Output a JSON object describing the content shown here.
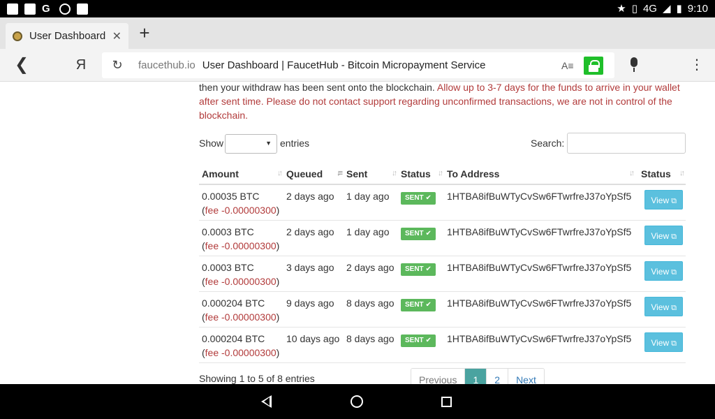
{
  "statusbar": {
    "network": "4G",
    "network_sup": "4G",
    "time": "9:10"
  },
  "tabs": [
    {
      "label": "User Dashboard"
    }
  ],
  "address": {
    "domain": "faucethub.io",
    "title": "User Dashboard | FaucetHub - Bitcoin Micropayment Service"
  },
  "notice": {
    "text": "then your withdraw has been sent onto the blockchain. ",
    "warning": "Allow up to 3-7 days for the funds to arrive in your wallet after sent time. Please do not contact support regarding unconfirmed transactions, we are not in control of the blockchain."
  },
  "controls": {
    "show_label": "Show",
    "entries_label": "entries",
    "search_label": "Search:",
    "search_value": ""
  },
  "table": {
    "columns": [
      "Amount",
      "Queued",
      "Sent",
      "Status",
      "To Address",
      "Status"
    ],
    "rows": [
      {
        "amount": "0.00035 BTC",
        "fee": "fee -0.00000300",
        "queued": "2 days ago",
        "sent": "1 day ago",
        "status": "SENT",
        "address": "1HTBA8ifBuWTyCvSw6FTwrfreJ37oYpSf5",
        "action": "View"
      },
      {
        "amount": "0.0003 BTC",
        "fee": "fee -0.00000300",
        "queued": "2 days ago",
        "sent": "1 day ago",
        "status": "SENT",
        "address": "1HTBA8ifBuWTyCvSw6FTwrfreJ37oYpSf5",
        "action": "View"
      },
      {
        "amount": "0.0003 BTC",
        "fee": "fee -0.00000300",
        "queued": "3 days ago",
        "sent": "2 days ago",
        "status": "SENT",
        "address": "1HTBA8ifBuWTyCvSw6FTwrfreJ37oYpSf5",
        "action": "View"
      },
      {
        "amount": "0.000204 BTC",
        "fee": "fee -0.00000300",
        "queued": "9 days ago",
        "sent": "8 days ago",
        "status": "SENT",
        "address": "1HTBA8ifBuWTyCvSw6FTwrfreJ37oYpSf5",
        "action": "View"
      },
      {
        "amount": "0.000204 BTC",
        "fee": "fee -0.00000300",
        "queued": "10 days ago",
        "sent": "8 days ago",
        "status": "SENT",
        "address": "1HTBA8ifBuWTyCvSw6FTwrfreJ37oYpSf5",
        "action": "View"
      }
    ]
  },
  "footer": {
    "info": "Showing 1 to 5 of 8 entries",
    "pager": [
      "Previous",
      "1",
      "2",
      "Next"
    ],
    "active_page": "1"
  },
  "colors": {
    "sent_badge": "#5cb85c",
    "view_button": "#5bc0de",
    "warning_text": "#b23b3b",
    "lock_green": "#1fbf2a",
    "pager_active": "#4aa3a0"
  }
}
